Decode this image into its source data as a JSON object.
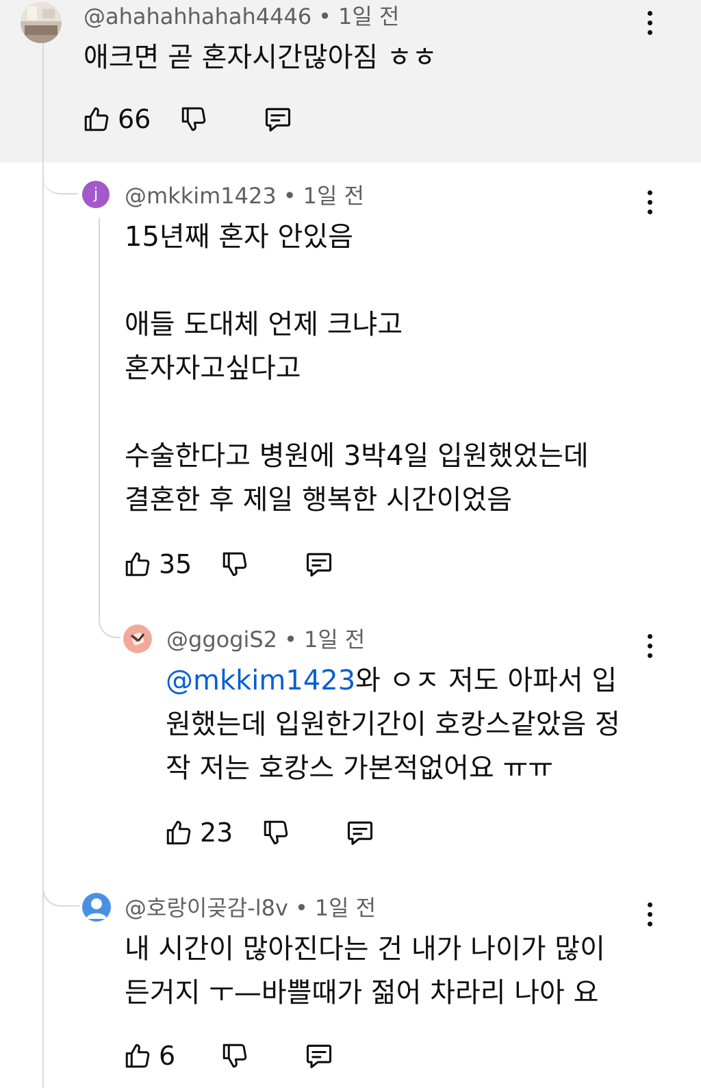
{
  "comments": [
    {
      "handle": "@ahahahhahah4446",
      "time": "1일 전",
      "text": "애크면 곧 혼자시간많아짐 ㅎㅎ",
      "likes": "66"
    },
    {
      "handle": "@mkkim1423",
      "avatar_letter": "j",
      "avatar_color": "#a259c9",
      "time": "1일 전",
      "text": "15년째 혼자 안있음\n\n애들 도대체 언제 크냐고\n혼자자고싶다고\n\n수술한다고 병원에 3박4일 입원했었는데\n결혼한 후 제일 행복한 시간이었음",
      "likes": "35"
    },
    {
      "handle": "@ggogiS2",
      "time": "1일 전",
      "mention": "@mkkim1423",
      "text_line1": "와 ㅇㅈ 저도 아파서 입",
      "text_rest": "원했는데 입원한기간이 호캉스같았음 정\n작 저는 호캉스 가본적없어요 ㅠㅠ",
      "likes": "23"
    },
    {
      "handle": "@호랑이곶감-l8v",
      "avatar_color": "#4a90e2",
      "time": "1일 전",
      "text": "내 시간이 많아진다는 건 내가 나이가 많이\n든거지 ㅜ—바쁠때가 젊어 차라리 나아 요",
      "likes": "6"
    }
  ],
  "separator": "•",
  "colors": {
    "mention": "#065fd4",
    "meta": "#606060",
    "highlight_bg": "#f2f2f2"
  },
  "icons": [
    "like-icon",
    "dislike-icon",
    "reply-icon",
    "more-vert-icon"
  ]
}
